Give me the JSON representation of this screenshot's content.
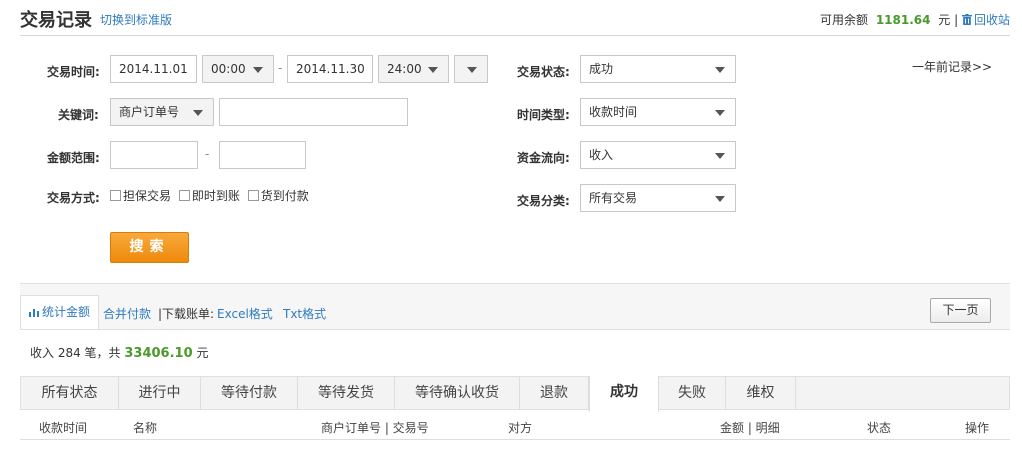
{
  "header": {
    "title": "交易记录",
    "switch_link": "切换到标准版",
    "balance_label": "可用余额",
    "balance_value": "1181.64",
    "balance_unit": "元 |",
    "recycle_link": "回收站"
  },
  "filters": {
    "trade_time_label": "交易时间:",
    "start_date": "2014.11.01",
    "start_time": "00:00",
    "range_dash": "-",
    "end_date": "2014.11.30",
    "end_time": "24:00",
    "keyword_label": "关键词:",
    "keyword_type": "商户订单号",
    "keyword_value": "",
    "amount_label": "金额范围:",
    "amount_min": "",
    "amount_dash": "-",
    "amount_max": "",
    "method_label": "交易方式:",
    "methods": [
      "担保交易",
      "即时到账",
      "货到付款"
    ],
    "status_label": "交易状态:",
    "status_value": "成功",
    "time_type_label": "时间类型:",
    "time_type_value": "收款时间",
    "flow_label": "资金流向:",
    "flow_value": "收入",
    "category_label": "交易分类:",
    "category_value": "所有交易",
    "search_button": "搜索",
    "history_link": "一年前记录>>"
  },
  "toolbar": {
    "stats_tab": "统计金额",
    "merge_link": "合并付款",
    "download_label": "|下载账单:",
    "excel_link": "Excel格式",
    "txt_link": "Txt格式",
    "next_page": "下一页"
  },
  "summary": {
    "prefix": "收入 284 笔，共",
    "amount": "33406.10",
    "unit": "元"
  },
  "status_tabs": [
    "所有状态",
    "进行中",
    "等待付款",
    "等待发货",
    "等待确认收货",
    "退款",
    "成功",
    "失败",
    "维权"
  ],
  "active_status_tab": "成功",
  "table": {
    "columns": [
      "收款时间",
      "名称",
      "商户订单号 | 交易号",
      "对方",
      "金额 | 明细",
      "状态",
      "操作"
    ]
  },
  "colors": {
    "link": "#2f7bbf",
    "amount_green": "#4a9a2a",
    "search_orange": "#f29a1f"
  }
}
